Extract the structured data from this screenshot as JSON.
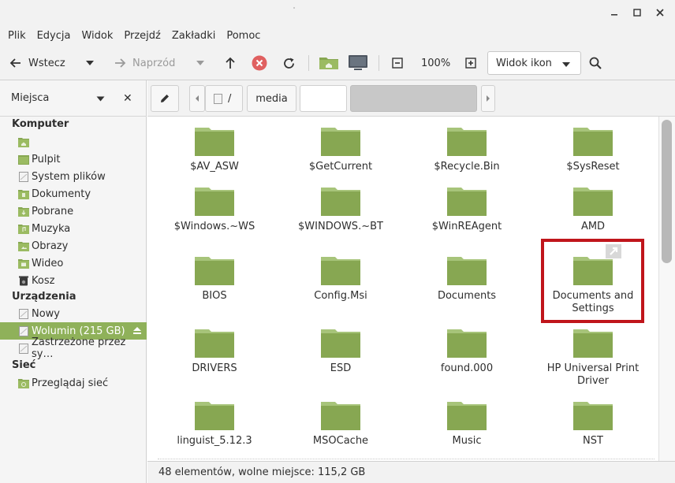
{
  "menu": [
    "Plik",
    "Edycja",
    "Widok",
    "Przejdź",
    "Zakładki",
    "Pomoc"
  ],
  "toolbar": {
    "back_label": "Wstecz",
    "forward_label": "Naprzód",
    "zoom": "100%",
    "view_mode": "Widok ikon"
  },
  "sidebar": {
    "title": "Miejsca",
    "sections": {
      "computer": "Komputer",
      "devices": "Urządzenia",
      "network": "Sieć"
    },
    "computer_items": [
      "",
      "Pulpit",
      "System plików",
      "Dokumenty",
      "Pobrane",
      "Muzyka",
      "Obrazy",
      "Wideo",
      "Kosz"
    ],
    "device_items": [
      "Nowy",
      "Wolumin (215 GB)",
      "Zastrzeżone przez sy…"
    ],
    "network_items": [
      "Przeglądaj sieć"
    ]
  },
  "path": {
    "root": "/",
    "segment": "media"
  },
  "files": [
    "$AV_ASW",
    "$GetCurrent",
    "$Recycle.Bin",
    "$SysReset",
    "$Windows.~WS",
    "$WINDOWS.~BT",
    "$WinREAgent",
    "AMD",
    "BIOS",
    "Config.Msi",
    "Documents",
    "Documents and Settings",
    "DRIVERS",
    "ESD",
    "found.000",
    "HP Universal Print Driver",
    "linguist_5.12.3",
    "MSOCache",
    "Music",
    "NST"
  ],
  "status": "48 elementów, wolne miejsce: 115,2 GB",
  "colors": {
    "folder": "#87a752",
    "folder_tab": "#a7c47a",
    "accent": "#8fb15a",
    "highlight": "#c0151b",
    "stop": "#e06060"
  }
}
